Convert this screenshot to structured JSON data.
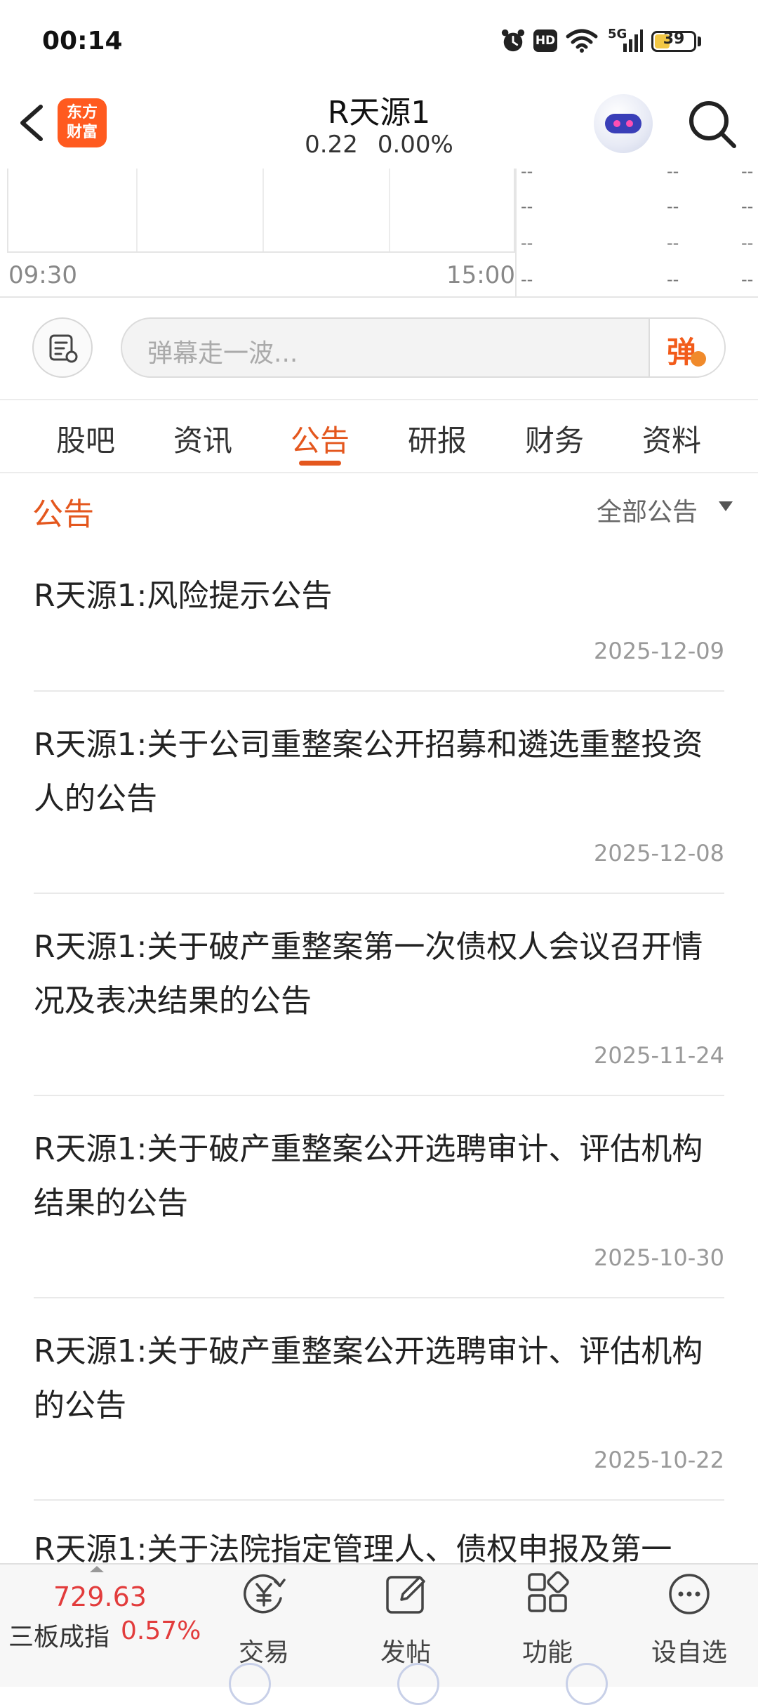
{
  "status_bar": {
    "time": "00:14",
    "network": "5G",
    "hd_badge": "HD",
    "battery": "39",
    "battery_level": 0.39,
    "icons": [
      "alarm-icon",
      "hd-icon",
      "wifi-icon",
      "signal-5g-icon",
      "battery-icon"
    ]
  },
  "header": {
    "logo_line1": "东方",
    "logo_line2": "财富",
    "stock_name": "R天源1",
    "price": "0.22",
    "change_pct": "0.00%",
    "icons": [
      "back-arrow-icon",
      "robot-avatar-icon",
      "search-icon"
    ]
  },
  "mini_chart": {
    "time_start": "09:30",
    "time_end": "15:00",
    "placeholder": "--"
  },
  "danmu": {
    "placeholder": "弹幕走一波...",
    "send_label": "弹"
  },
  "tabs": [
    {
      "label": "股吧",
      "active": false
    },
    {
      "label": "资讯",
      "active": false
    },
    {
      "label": "公告",
      "active": true
    },
    {
      "label": "研报",
      "active": false
    },
    {
      "label": "财务",
      "active": false
    },
    {
      "label": "资料",
      "active": false
    }
  ],
  "section": {
    "title": "公告",
    "filter": "全部公告"
  },
  "announcements": [
    {
      "title": "R天源1:风险提示公告",
      "date": "2025-12-09"
    },
    {
      "title": "R天源1:关于公司重整案公开招募和遴选重整投资人的公告",
      "date": "2025-12-08"
    },
    {
      "title": "R天源1:关于破产重整案第一次债权人会议召开情况及表决结果的公告",
      "date": "2025-11-24"
    },
    {
      "title": "R天源1:关于破产重整案公开选聘审计、评估机构结果的公告",
      "date": "2025-10-30"
    },
    {
      "title": "R天源1:关于破产重整案公开选聘审计、评估机构的公告",
      "date": "2025-10-22"
    },
    {
      "title": "R天源1:关于法院指定管理人、债权申报及第一",
      "date": ""
    }
  ],
  "bottom_bar": {
    "index_value": "729.63",
    "index_name": "三板成指",
    "index_change": "0.57%",
    "items": [
      {
        "label": "交易",
        "icon": "trade-yen-icon"
      },
      {
        "label": "发帖",
        "icon": "edit-post-icon"
      },
      {
        "label": "功能",
        "icon": "grid-apps-icon"
      },
      {
        "label": "设自选",
        "icon": "more-dots-icon"
      }
    ]
  },
  "colors": {
    "accent": "#e4571e",
    "logo": "#ff5a1f",
    "up_red": "#e23c3c",
    "muted": "#999999"
  }
}
